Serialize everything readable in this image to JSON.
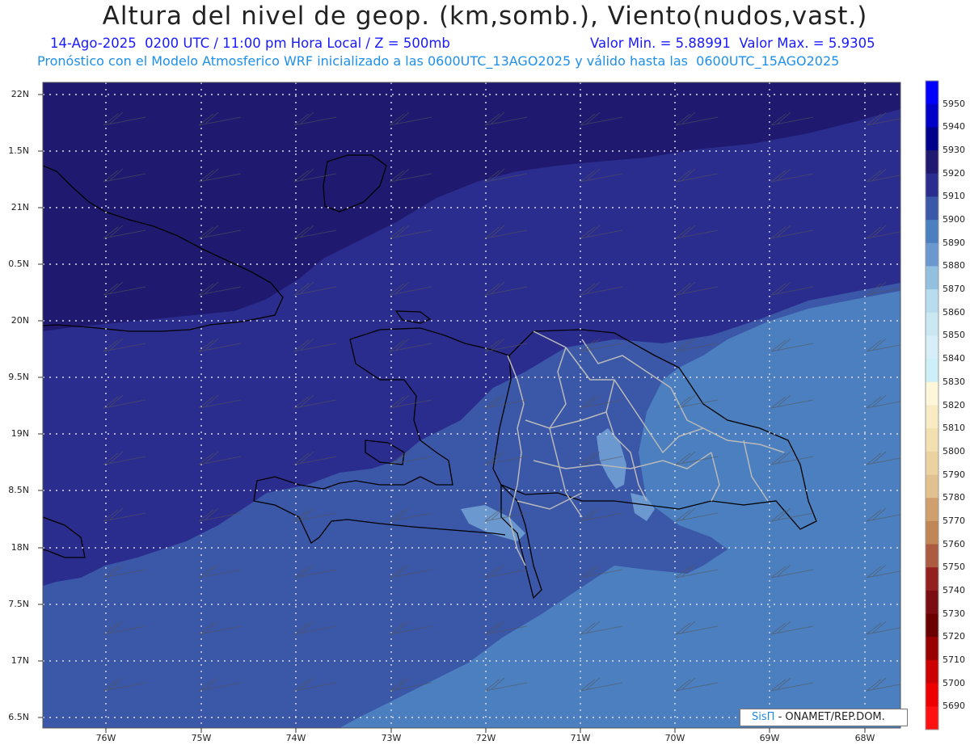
{
  "header": {
    "title": "Altura del nivel de geop. (km,somb.), Viento(nudos,vast.)",
    "line1": "14-Ago-2025  0200 UTC / 11:00 pm Hora Local / Z = 500mb",
    "line1_right": "Valor Min. = 5.88991  Valor Max. = 5.9305",
    "line2": "Pronóstico con el Modelo Atmosferico WRF inicializado a las 0600UTC_13AGO2025 y válido hasta las  0600UTC_15AGO2025"
  },
  "map": {
    "lat_labels": [
      "22N",
      "1.5N",
      "21N",
      "0.5N",
      "20N",
      "9.5N",
      "19N",
      "8.5N",
      "18N",
      "7.5N",
      "17N",
      "6.5N"
    ],
    "lon_labels": [
      "76W",
      "75W",
      "74W",
      "73W",
      "72W",
      "71W",
      "70W",
      "69W",
      "68W"
    ],
    "shading_colors": {
      "band_5920": "#1f1a70",
      "band_5910": "#2b2d8e",
      "band_5900": "#3b57a8",
      "band_5890": "#4b7fbf",
      "band_5880": "#6b98cf"
    },
    "coastline_color": "#000000",
    "province_border_color": "#b9b9b9",
    "grid": "dotted-white"
  },
  "colorbar": {
    "levels": [
      "5950",
      "5940",
      "5930",
      "5920",
      "5910",
      "5900",
      "5890",
      "5880",
      "5870",
      "5860",
      "5850",
      "5840",
      "5830",
      "5820",
      "5810",
      "5800",
      "5790",
      "5780",
      "5770",
      "5760",
      "5750",
      "5740",
      "5730",
      "5720",
      "5710",
      "5700",
      "5690"
    ],
    "colors": [
      "#0000ff",
      "#0000c8",
      "#00008b",
      "#1f1a70",
      "#2b2d8e",
      "#3b57a8",
      "#4b7fbf",
      "#6b98cf",
      "#94c0e0",
      "#b7dced",
      "#c9e8f2",
      "#d6eef7",
      "#cdeff7",
      "#fdf6d8",
      "#f8ebc4",
      "#f2e0b0",
      "#ecd2a0",
      "#e2c191",
      "#cfa06e",
      "#c08656",
      "#ac5a40",
      "#941f1f",
      "#7a0d12",
      "#6b0000",
      "#990000",
      "#cc0000",
      "#ee0000",
      "#ff1111"
    ]
  },
  "credit": {
    "brand": "SisΠ",
    "text": "- ONAMET/REP.DOM."
  }
}
